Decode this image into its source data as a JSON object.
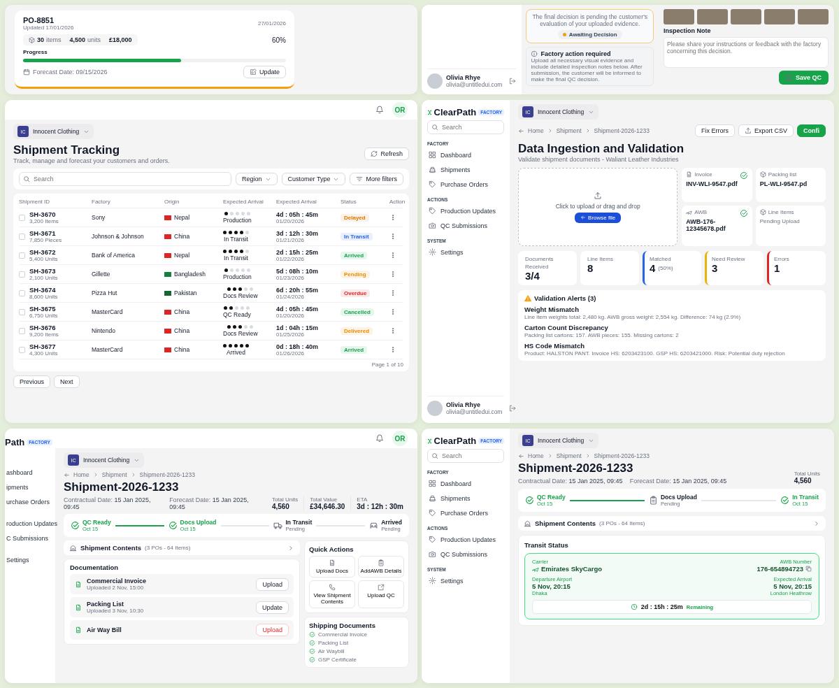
{
  "po_card": {
    "title": "PO-8851",
    "updated": "Updated 17/01/2026",
    "due_date": "27/01/2026",
    "stats": [
      {
        "value": "30",
        "unit": "items"
      },
      {
        "value": "4,500",
        "unit": "units"
      },
      {
        "value": "£18,000"
      }
    ],
    "progress_label": "Progress",
    "level": 0.6,
    "percent": "60%",
    "forecast_label": "Forecast Date:",
    "forecast_date": "09/15/2026",
    "update_button": "Update"
  },
  "qc_panel": {
    "user": {
      "name": "Olivia Rhye",
      "email": "olivia@untitledui.com"
    },
    "decision_text": "The final decision is pending the customer's evaluation of your uploaded evidence.",
    "badge": {
      "label": "Awaiting Decision",
      "color": "#f59e0b"
    },
    "notice": {
      "title": "Factory action required",
      "text": "Upload all necessary visual evidence and include detailed inspection notes below. After submission, the customer will be informed to make the final QC decision."
    },
    "note_label": "Inspection Note",
    "note_placeholder": "Please share your instructions or feedback with the factory concerning this decision.",
    "save_button": "Save QC"
  },
  "tracking": {
    "avatar": "OR",
    "workspace": {
      "initials": "IC",
      "name": "Innocent Clothing"
    },
    "title": "Shipment Tracking",
    "subtitle": "Track, manage and forecast your customers and orders.",
    "refresh": "Refresh",
    "search_placeholder": "Search",
    "filters": [
      {
        "label": "Region",
        "kind": "dropdown"
      },
      {
        "label": "Customer Type",
        "kind": "dropdown"
      },
      {
        "label": "More filters",
        "kind": "filter"
      }
    ],
    "columns": [
      "Shipment ID",
      "Factory",
      "Origin",
      "Expected Arrival",
      "Expected Arrival",
      "Status",
      "Action"
    ],
    "rows": [
      {
        "id": "SH-3670",
        "quantity": "3,200 Items",
        "factory": "Sony",
        "origin": {
          "name": "Nepal",
          "color": "#dc2626"
        },
        "stars": 1,
        "stage": "Production",
        "countdown": "4d : 05h : 45m",
        "date": "01/20/2026",
        "status": {
          "label": "Delayed",
          "color": "#d97706"
        },
        "checked": false
      },
      {
        "id": "SH-3671",
        "quantity": "7,850 Pieces",
        "factory": "Johnson & Johnson",
        "origin": {
          "name": "China",
          "color": "#dc2626"
        },
        "stars": 4,
        "stage": "In Transit",
        "countdown": "3d : 12h : 30m",
        "date": "01/21/2026",
        "status": {
          "label": "In Transit",
          "color": "#2563eb"
        },
        "checked": false
      },
      {
        "id": "SH-3672",
        "quantity": "5,400 Units",
        "factory": "Bank of America",
        "origin": {
          "name": "Nepal",
          "color": "#dc2626"
        },
        "stars": 4,
        "stage": "In Transit",
        "countdown": "2d : 15h : 25m",
        "date": "01/22/2026",
        "status": {
          "label": "Arrived",
          "color": "#16a34a"
        },
        "checked": false
      },
      {
        "id": "SH-3673",
        "quantity": "2,100 Units",
        "factory": "Gillette",
        "origin": {
          "name": "Bangladesh",
          "color": "#15803d"
        },
        "stars": 1,
        "stage": "Production",
        "countdown": "5d : 08h : 10m",
        "date": "01/23/2026",
        "status": {
          "label": "Pending",
          "color": "#ea8c00"
        },
        "checked": false
      },
      {
        "id": "SH-3674",
        "quantity": "8,600 Units",
        "factory": "Pizza Hut",
        "origin": {
          "name": "Pakistan",
          "color": "#166534"
        },
        "stars": 3,
        "stage": "Docs Review",
        "countdown": "6d : 20h : 55m",
        "date": "01/24/2026",
        "status": {
          "label": "Overdue",
          "color": "#dc2626"
        },
        "checked": false
      },
      {
        "id": "SH-3675",
        "quantity": "6,750 Units",
        "factory": "MasterCard",
        "origin": {
          "name": "China",
          "color": "#dc2626"
        },
        "stars": 2,
        "stage": "QC Ready",
        "countdown": "4d : 05h : 45m",
        "date": "01/20/2026",
        "status": {
          "label": "Cancelled",
          "color": "#16a34a"
        },
        "checked": false
      },
      {
        "id": "SH-3676",
        "quantity": "9,200 Items",
        "factory": "Nintendo",
        "origin": {
          "name": "China",
          "color": "#dc2626"
        },
        "stars": 3,
        "stage": "Docs Review",
        "countdown": "1d : 04h : 15m",
        "date": "01/25/2026",
        "status": {
          "label": "Delivered",
          "color": "#ea8c00"
        },
        "checked": false
      },
      {
        "id": "SH-3677",
        "quantity": "4,300 Units",
        "factory": "MasterCard",
        "origin": {
          "name": "China",
          "color": "#dc2626"
        },
        "stars": 5,
        "stage": "Arrived",
        "countdown": "0d : 18h : 40m",
        "date": "01/26/2026",
        "status": {
          "label": "Arrived",
          "color": "#16a34a"
        },
        "checked": false
      }
    ],
    "pagination": {
      "page": "Page 1 of 10",
      "previous": "Previous",
      "next": "Next"
    }
  },
  "ingestion": {
    "sidebar": {
      "logo": "ClearPath",
      "tag": "FACTORY",
      "search_placeholder": "Search",
      "sections": [
        {
          "title": "FACTORY",
          "items": [
            "Dashboard",
            "Shipments",
            "Purchase Orders"
          ]
        },
        {
          "title": "ACTIONS",
          "items": [
            "Production Updates",
            "QC Submissions"
          ]
        },
        {
          "title": "SYSTEM",
          "items": [
            "Settings"
          ]
        }
      ],
      "user": {
        "name": "Olivia Rhye",
        "email": "olivia@untitledui.com"
      }
    },
    "workspace": {
      "initials": "IC",
      "name": "Innocent Clothing"
    },
    "breadcrumb": [
      "Home",
      "Shipment",
      "Shipment-2026-1233"
    ],
    "actions": [
      {
        "label": "Fix Errors",
        "kind": "plain"
      },
      {
        "label": "Export CSV",
        "kind": "export"
      },
      {
        "label": "Confi",
        "kind": "primary"
      }
    ],
    "title": "Data Ingestion and Validation",
    "subtitle": "Validate shipment documents - Waliant Leather Industries",
    "upload": {
      "text": "Click to upload or drag and drop",
      "button": "Browse file"
    },
    "documents": [
      {
        "type": "Invoice",
        "file": "INV-WLI-9547.pdf",
        "verified": true
      },
      {
        "type": "Packing list",
        "file": "PL-WLI-9547.pd",
        "verified": false
      },
      {
        "type": "AWB",
        "file": "AWB-176-12345678.pdf",
        "verified": true
      },
      {
        "type": "Line Items",
        "note": "Pending Upload",
        "verified": false
      }
    ],
    "stats": [
      {
        "label": "Documents Received",
        "value": "3/4"
      },
      {
        "label": "Line Items",
        "value": "8"
      },
      {
        "label": "Matched",
        "value": "4",
        "note": "(50%)",
        "color": "#2563eb"
      },
      {
        "label": "Need Review",
        "value": "3",
        "color": "#eab308"
      },
      {
        "label": "Errors",
        "value": "1",
        "color": "#dc2626"
      }
    ],
    "alerts": {
      "title": "Validation Alerts (3)",
      "items": [
        {
          "title": "Weight Mismatch",
          "text": "Line item weights total: 2,480 kg. AWB gross weight: 2,554 kg. Difference: 74 kg (2.9%)"
        },
        {
          "title": "Carton Count Discrepancy",
          "text": "Packing list cartons: 157. AWB pieces: 155. Missing cartons: 2"
        },
        {
          "title": "HS Code Mismatch",
          "text": "Product: HALSTON PANT. Invoice HS: 6203423100. GSP HS: 6203421000. Risk: Potential duty rejection"
        }
      ]
    }
  },
  "shipment_docs": {
    "avatar": "OR",
    "sidebar_fragment": {
      "logo": "Path",
      "tag": "FACTORY",
      "items": [
        "ashboard",
        "ipments",
        "urchase Orders",
        "roduction Updates",
        "C Submissions",
        "Settings"
      ]
    },
    "workspace": {
      "initials": "IC",
      "name": "Innocent Clothing"
    },
    "breadcrumb": [
      "Home",
      "Shipment",
      "Shipment-2026-1233"
    ],
    "title": "Shipment-2026-1233",
    "dates": [
      {
        "label": "Contractual Date:",
        "value": "15 Jan 2025, 09:45"
      },
      {
        "label": "Forecast Date:",
        "value": "15 Jan 2025, 09:45"
      }
    ],
    "totals": [
      {
        "label": "Total Units",
        "value": "4,560"
      },
      {
        "label": "Total Value",
        "value": "£34,646.30"
      },
      {
        "label": "ETA",
        "value": "3d : 12h : 30m"
      }
    ],
    "steps": [
      {
        "label": "QC Ready",
        "date": "Oct 15",
        "done": true
      },
      {
        "label": "Docs Upload",
        "date": "Oct 15",
        "done": true
      },
      {
        "label": "In Transit",
        "date": "Pending",
        "done": false
      },
      {
        "label": "Arrived",
        "date": "Pending",
        "done": false
      }
    ],
    "contents": {
      "title": "Shipment Contents",
      "count": "(3 POs - 64 Items)"
    },
    "documentation": {
      "title": "Documentation",
      "items": [
        {
          "name": "Commercial Invoice",
          "uploaded": "Uploaded 2 Nov, 15:00",
          "action": "Upload",
          "urgent": false
        },
        {
          "name": "Packing List",
          "uploaded": "Uploaded 3 Nov, 10:30",
          "action": "Update",
          "urgent": false
        },
        {
          "name": "Air Way Bill",
          "action": "Upload",
          "urgent": true
        }
      ]
    },
    "quick_actions": {
      "title": "Quick Actions",
      "items": [
        "Upload Docs",
        "AddAWB Details",
        "View Shipment Contents",
        "Upload QC"
      ]
    },
    "shipping_documents": {
      "title": "Shipping Documents",
      "items": [
        "Commercial Invoice",
        "Packing List",
        "Air Waybill",
        "GSP Certificate"
      ]
    }
  },
  "shipment_transit": {
    "sidebar": {
      "logo": "ClearPath",
      "tag": "FACTORY",
      "search_placeholder": "Search",
      "sections": [
        {
          "title": "FACTORY",
          "items": [
            "Dashboard",
            "Shipments",
            "Purchase Orders"
          ]
        },
        {
          "title": "ACTIONS",
          "items": [
            "Production Updates",
            "QC Submissions"
          ]
        },
        {
          "title": "SYSTEM",
          "items": [
            "Settings"
          ]
        }
      ]
    },
    "workspace": {
      "initials": "IC",
      "name": "Innocent Clothing"
    },
    "breadcrumb": [
      "Home",
      "Shipment",
      "Shipment-2026-1233"
    ],
    "title": "Shipment-2026-1233",
    "dates": [
      {
        "label": "Contractual Date:",
        "value": "15 Jan 2025, 09:45"
      },
      {
        "label": "Forecast Date:",
        "value": "15 Jan 2025, 09:45"
      }
    ],
    "totals": [
      {
        "label": "Total Units",
        "value": "4,560"
      }
    ],
    "steps": [
      {
        "label": "QC Ready",
        "date": "Oct 15",
        "done": true
      },
      {
        "label": "Docs Upload",
        "date": "Pending",
        "done": false
      },
      {
        "label": "In Transit",
        "date": "Oct 15",
        "done": true
      }
    ],
    "contents": {
      "title": "Shipment Contents",
      "count": "(3 POs - 64 Items)"
    },
    "transit": {
      "title": "Transit Status",
      "carrier_label": "Carrier",
      "carrier": "Emirates SkyCargo",
      "awb_label": "AWB Number",
      "awb": "176-654894723",
      "departure_label": "Departure Airport",
      "departure": "5 Nov, 20:15",
      "departure_place": "Dhaka",
      "arrival_label": "Expected Arrival",
      "arrival": "5 Nov, 20:15",
      "arrival_place": "London Heathrow",
      "remaining": "2d : 15h : 25m",
      "remaining_label": "Remaining"
    }
  }
}
